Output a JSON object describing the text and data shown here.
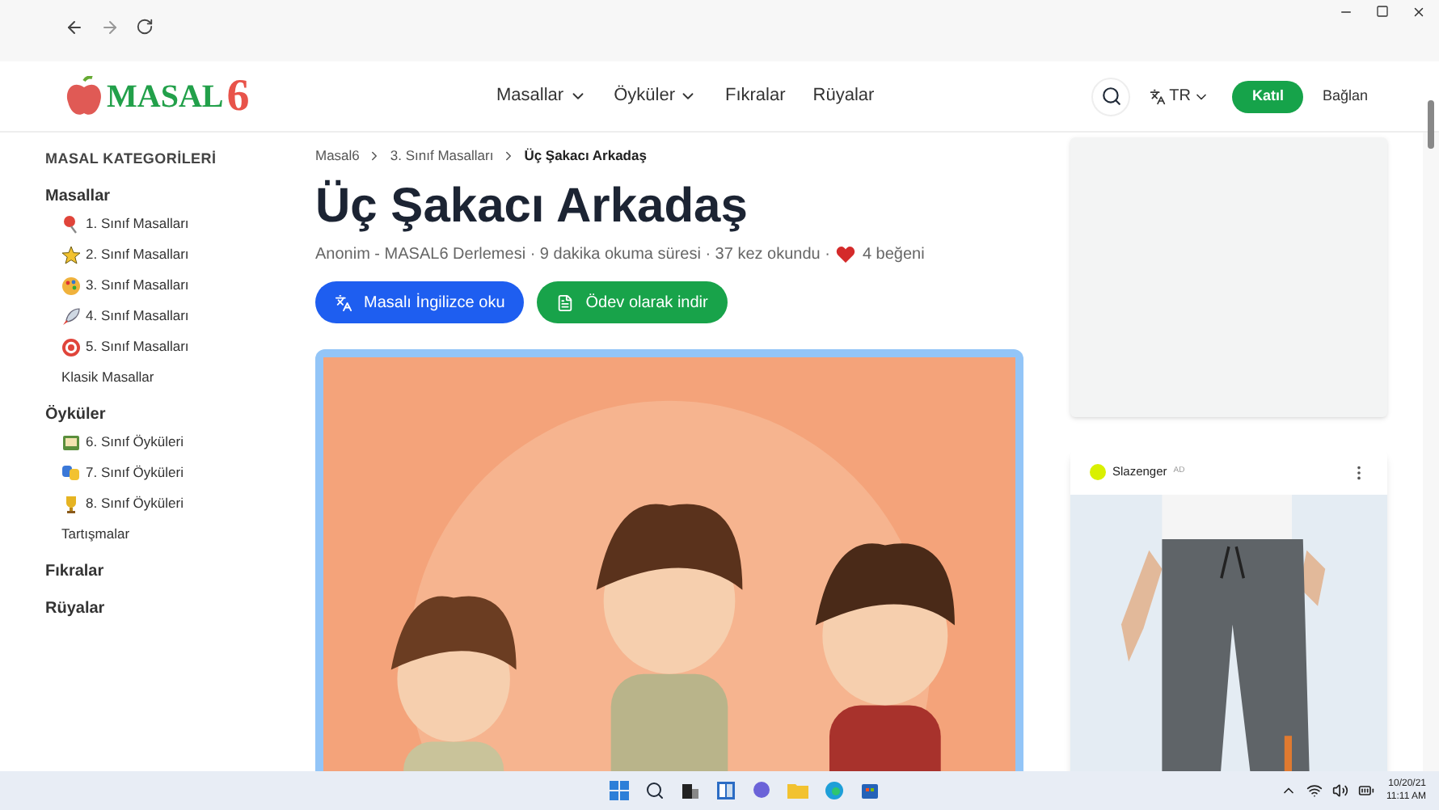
{
  "site_header": {
    "logo": "MASAL",
    "logo_digit": "6",
    "nav": [
      {
        "label": "Masallar",
        "dropdown": true
      },
      {
        "label": "Öyküler",
        "dropdown": true
      },
      {
        "label": "Fıkralar",
        "dropdown": false
      },
      {
        "label": "Rüyalar",
        "dropdown": false
      }
    ],
    "language": "TR",
    "join_button": "Katıl",
    "connect_link": "Bağlan"
  },
  "sidebar": {
    "title": "MASAL KATEGORİLERİ",
    "groups": [
      {
        "label": "Masallar",
        "children": [
          {
            "label": "1. Sınıf Masalları",
            "kind": "icon"
          },
          {
            "label": "2. Sınıf Masalları",
            "kind": "icon"
          },
          {
            "label": "3. Sınıf Masalları",
            "kind": "icon"
          },
          {
            "label": "4. Sınıf Masalları",
            "kind": "icon"
          },
          {
            "label": "5. Sınıf Masalları",
            "kind": "icon"
          },
          {
            "label": "Klasik Masallar",
            "kind": "plain"
          }
        ]
      },
      {
        "label": "Öyküler",
        "children": [
          {
            "label": "6. Sınıf Öyküleri",
            "kind": "icon"
          },
          {
            "label": "7. Sınıf Öyküleri",
            "kind": "icon"
          },
          {
            "label": "8. Sınıf Öyküleri",
            "kind": "icon"
          },
          {
            "label": "Tartışmalar",
            "kind": "plain"
          }
        ]
      },
      {
        "label": "Fıkralar"
      },
      {
        "label": "Rüyalar"
      }
    ]
  },
  "breadcrumb": [
    "Masal6",
    "3. Sınıf Masalları",
    "Üç Şakacı Arkadaş"
  ],
  "article": {
    "title": "Üç Şakacı Arkadaş",
    "meta": "Anonim - MASAL6 Derlemesi · 9 dakika okuma süresi · 37 kez okundu ·",
    "likes": "4 beğeni",
    "buttons": [
      {
        "label": "Masalı İngilizce oku",
        "kind": "translate"
      },
      {
        "label": "Ödev olarak indir",
        "kind": "download"
      }
    ]
  },
  "ad": {
    "brand": "Slazenger",
    "tag": "AD"
  },
  "taskbar": {
    "date": "10/20/21",
    "time": "11:11 AM"
  }
}
